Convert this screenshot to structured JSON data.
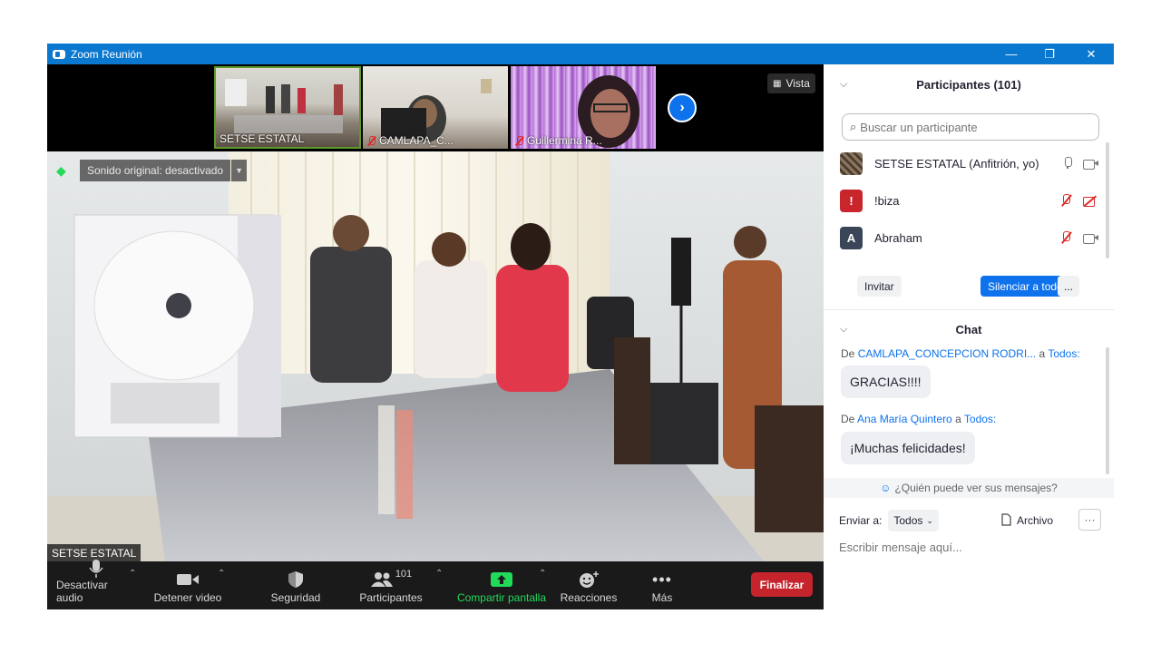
{
  "window": {
    "title": "Zoom Reunión"
  },
  "thumbnails": [
    {
      "name": "SETSE ESTATAL",
      "muted": false
    },
    {
      "name": "CAMLAPA_C...",
      "muted": true
    },
    {
      "name": "Guillermina R...",
      "muted": true
    }
  ],
  "view_button": "Vista",
  "sound_notice": "Sonido original: desactivado",
  "active_speaker": "SETSE ESTATAL",
  "toolbar": {
    "mute": "Desactivar audio",
    "video": "Detener video",
    "security": "Seguridad",
    "participants": "Participantes",
    "participants_count": "101",
    "share": "Compartir pantalla",
    "reactions": "Reacciones",
    "more": "Más",
    "end": "Finalizar"
  },
  "participants_panel": {
    "title": "Participantes (101)",
    "search_placeholder": "Buscar un participante",
    "rows": [
      {
        "initial": "",
        "name": "SETSE ESTATAL (Anfitrión, yo)",
        "avatar_color": "#6b5a44",
        "muted": false,
        "video_off": false
      },
      {
        "initial": "!",
        "name": "!biza",
        "avatar_color": "#c8262c",
        "muted": true,
        "video_off": true
      },
      {
        "initial": "A",
        "name": "Abraham",
        "avatar_color": "#3a4658",
        "muted": true,
        "video_off": false
      }
    ],
    "invite": "Invitar",
    "mute_all": "Silenciar a todos",
    "more": "..."
  },
  "chat_panel": {
    "title": "Chat",
    "messages": [
      {
        "prefix": "De",
        "sender": "CAMLAPA_CONCEPCION RODRI...",
        "to_word": "a",
        "recipient": "Todos:",
        "text": "GRACIAS!!!!"
      },
      {
        "prefix": "De",
        "sender": "Ana María Quintero",
        "to_word": "a",
        "recipient": "Todos:",
        "text": "¡Muchas felicidades!"
      }
    ],
    "who_sees": "¿Quién puede ver sus mensajes?",
    "send_to_label": "Enviar a:",
    "send_to_value": "Todos",
    "file_label": "Archivo",
    "more": "···",
    "input_placeholder": "Escribir mensaje aquí..."
  },
  "colors": {
    "titlebar": "#0b78d0",
    "accent_blue": "#0e72ed",
    "end_red": "#c6242c",
    "share_green": "#23d959"
  }
}
